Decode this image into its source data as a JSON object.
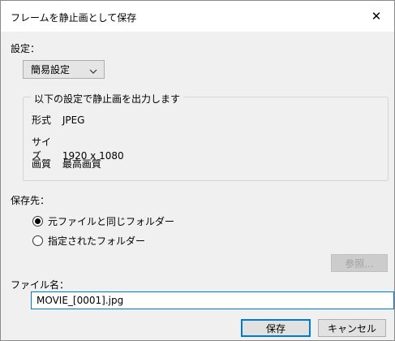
{
  "dialog": {
    "title": "フレームを静止画として保存",
    "close_label": "✕"
  },
  "settings": {
    "label": "設定：",
    "preset_selected": "簡易設定",
    "group_legend": "以下の設定で静止画を出力します",
    "format_key": "形式",
    "format_value": "JPEG",
    "size_key": "サイズ",
    "size_value": "1920 x 1080",
    "quality_key": "画質",
    "quality_value": "最高画質"
  },
  "destination": {
    "label": "保存先：",
    "option_same_folder": "元ファイルと同じフォルダー",
    "option_specified_folder": "指定されたフォルダー",
    "selected": "option_same_folder",
    "browse_label": "参照..."
  },
  "filename": {
    "label": "ファイル名：",
    "value": "MOVIE_[0001].jpg"
  },
  "footer": {
    "save_label": "保存",
    "cancel_label": "キャンセル"
  },
  "colors": {
    "accent": "#0078d7",
    "dialog_bg": "#f0f0f0",
    "disabled_text": "#a0a0a0"
  }
}
